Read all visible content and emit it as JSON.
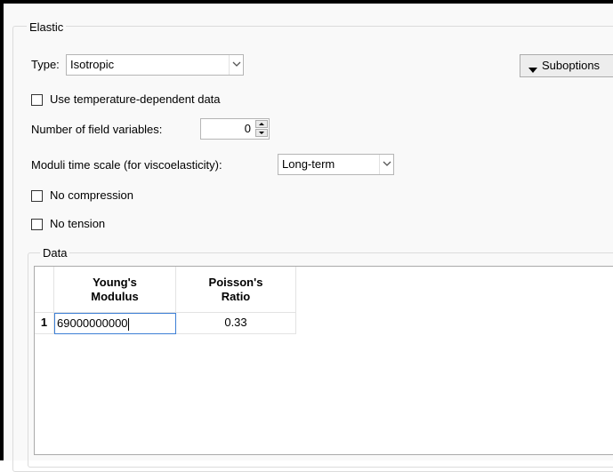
{
  "elastic": {
    "group_title": "Elastic",
    "type_label": "Type:",
    "type_value": "Isotropic",
    "suboptions_label": "Suboptions",
    "temp_dependent_label": "Use temperature-dependent data",
    "field_vars_label": "Number of field variables:",
    "field_vars_value": "0",
    "moduli_label": "Moduli time scale (for viscoelasticity):",
    "moduli_value": "Long-term",
    "no_compression_label": "No compression",
    "no_tension_label": "No tension"
  },
  "data": {
    "group_title": "Data",
    "columns": [
      {
        "line1": "Young's",
        "line2": "Modulus"
      },
      {
        "line1": "Poisson's",
        "line2": "Ratio"
      }
    ],
    "rows": [
      {
        "index": "1",
        "young": "69000000000",
        "poisson": "0.33"
      }
    ]
  },
  "checkboxes": {
    "temp_dependent": false,
    "no_compression": false,
    "no_tension": false
  },
  "icons": [
    "chevron-down-icon",
    "triangle-down-icon",
    "spin-up-icon",
    "spin-down-icon"
  ]
}
